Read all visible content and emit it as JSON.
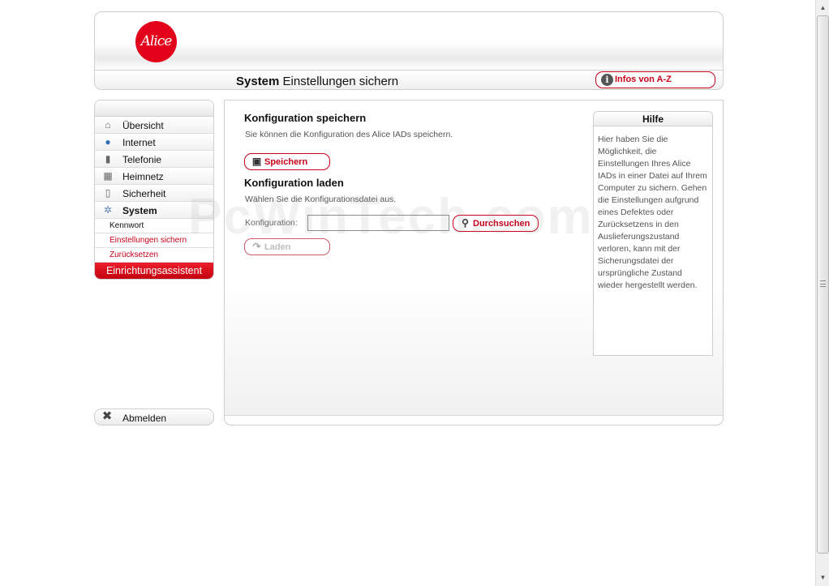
{
  "header": {
    "logo_text": "Alice",
    "title_bold": "System",
    "title_rest": " Einstellungen sichern",
    "infos_label": "Infos von A-Z",
    "brand_color": "#e2001a"
  },
  "sidebar": {
    "items": [
      {
        "label": "Übersicht",
        "icon": "house-icon"
      },
      {
        "label": "Internet",
        "icon": "globe-icon"
      },
      {
        "label": "Telefonie",
        "icon": "phone-icon"
      },
      {
        "label": "Heimnetz",
        "icon": "network-icon"
      },
      {
        "label": "Sicherheit",
        "icon": "lock-icon"
      },
      {
        "label": "System",
        "icon": "gears-icon",
        "active": true
      }
    ],
    "sub_items": [
      {
        "label": "Kennwort"
      },
      {
        "label": "Einstellungen sichern",
        "active": true
      },
      {
        "label": "Zurücksetzen"
      }
    ],
    "wizard_label": "Einrichtungsassistent",
    "logout_label": "Abmelden"
  },
  "main": {
    "save_section": {
      "title": "Konfiguration speichern",
      "description": "Sie können die Konfiguration des Alice IADs speichern.",
      "button_label": "Speichern"
    },
    "load_section": {
      "title": "Konfiguration laden",
      "description": "Wählen Sie die Konfigurationsdatei aus.",
      "field_label": "Konfiguration:",
      "field_value": "",
      "browse_label": "Durchsuchen",
      "load_label": "Laden"
    }
  },
  "help": {
    "title": "Hilfe",
    "text": "Hier haben Sie die Möglichkeit, die Einstellungen Ihres Alice IADs in einer Datei auf Ihrem Computer zu sichern. Gehen die Einstellungen aufgrund eines Defektes oder Zurücksetzens in den Auslieferungszustand verloren, kann mit der Sicherungsdatei der ursprüngliche Zustand wieder hergestellt werden."
  },
  "watermark": "PcWinTech.com"
}
